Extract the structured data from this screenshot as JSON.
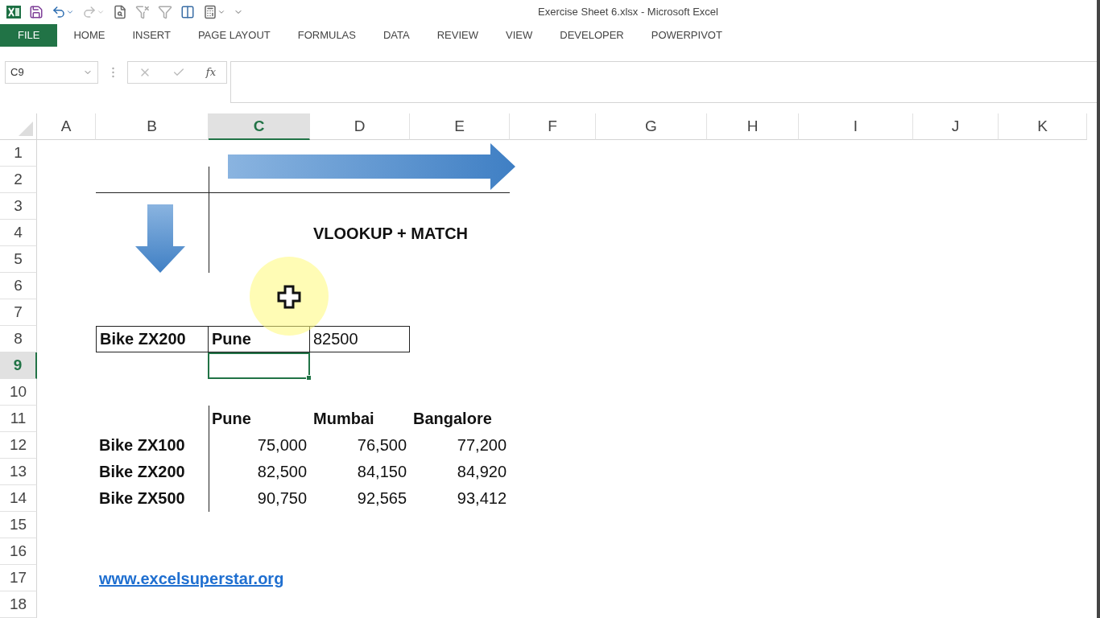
{
  "window": {
    "title": "Exercise Sheet 6.xlsx - Microsoft Excel"
  },
  "ribbon_tabs": [
    {
      "label": "FILE",
      "kind": "file",
      "selected": false
    },
    {
      "label": "HOME",
      "kind": "tab",
      "selected": false
    },
    {
      "label": "INSERT",
      "kind": "tab",
      "selected": false
    },
    {
      "label": "PAGE LAYOUT",
      "kind": "tab",
      "selected": false
    },
    {
      "label": "FORMULAS",
      "kind": "tab",
      "selected": false
    },
    {
      "label": "DATA",
      "kind": "tab",
      "selected": false
    },
    {
      "label": "REVIEW",
      "kind": "tab",
      "selected": false
    },
    {
      "label": "VIEW",
      "kind": "tab",
      "selected": false
    },
    {
      "label": "DEVELOPER",
      "kind": "tab",
      "selected": false
    },
    {
      "label": "POWERPIVOT",
      "kind": "tab",
      "selected": false
    }
  ],
  "formula_bar": {
    "name_box": "C9",
    "function_button": "fx"
  },
  "column_headers": [
    {
      "label": "A",
      "selected": false
    },
    {
      "label": "B",
      "selected": false
    },
    {
      "label": "C",
      "selected": true
    },
    {
      "label": "D",
      "selected": false
    },
    {
      "label": "E",
      "selected": false
    },
    {
      "label": "F",
      "selected": false
    },
    {
      "label": "G",
      "selected": false
    },
    {
      "label": "H",
      "selected": false
    },
    {
      "label": "I",
      "selected": false
    },
    {
      "label": "J",
      "selected": false
    },
    {
      "label": "K",
      "selected": false
    }
  ],
  "row_headers": [
    {
      "label": "1",
      "selected": false
    },
    {
      "label": "2",
      "selected": false
    },
    {
      "label": "3",
      "selected": false
    },
    {
      "label": "4",
      "selected": false
    },
    {
      "label": "5",
      "selected": false
    },
    {
      "label": "6",
      "selected": false
    },
    {
      "label": "7",
      "selected": false
    },
    {
      "label": "8",
      "selected": false
    },
    {
      "label": "9",
      "selected": true
    },
    {
      "label": "10",
      "selected": false
    },
    {
      "label": "11",
      "selected": false
    },
    {
      "label": "12",
      "selected": false
    },
    {
      "label": "13",
      "selected": false
    },
    {
      "label": "14",
      "selected": false
    },
    {
      "label": "15",
      "selected": false
    },
    {
      "label": "16",
      "selected": false
    },
    {
      "label": "17",
      "selected": false
    },
    {
      "label": "18",
      "selected": false
    }
  ],
  "heading": "VLOOKUP + MATCH",
  "lookup": {
    "product": "Bike ZX200",
    "city": "Pune",
    "result": "82500"
  },
  "price_table": {
    "columns": [
      "Pune",
      "Mumbai",
      "Bangalore"
    ],
    "rows": [
      {
        "product": "Bike ZX100",
        "prices": [
          "75,000",
          "76,500",
          "77,200"
        ]
      },
      {
        "product": "Bike ZX200",
        "prices": [
          "82,500",
          "84,150",
          "84,920"
        ]
      },
      {
        "product": "Bike ZX500",
        "prices": [
          "90,750",
          "92,565",
          "93,412"
        ]
      }
    ]
  },
  "link": "www.excelsuperstar.org"
}
